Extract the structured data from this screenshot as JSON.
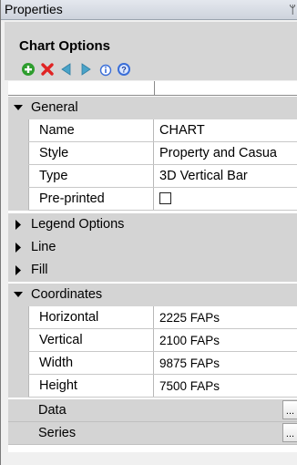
{
  "panel": {
    "title": "Properties",
    "pin_icon": "pin-icon"
  },
  "header": {
    "title": "Chart Options"
  },
  "toolbar": {
    "items": [
      {
        "icon": "add-icon",
        "color": "#2e9d2e"
      },
      {
        "icon": "delete-icon",
        "color": "#e02424"
      },
      {
        "icon": "move-left-icon",
        "color": "#4aa3c8"
      },
      {
        "icon": "move-right-icon",
        "color": "#4aa3c8"
      },
      {
        "icon": "info-icon",
        "color": "#3a6ed8"
      },
      {
        "icon": "help-icon",
        "color": "#3a6ed8"
      }
    ]
  },
  "grid": {
    "general": {
      "label": "General",
      "name_label": "Name",
      "name_value": "CHART",
      "style_label": "Style",
      "style_value": "Property and Casua",
      "type_label": "Type",
      "type_value": "3D Vertical Bar",
      "preprinted_label": "Pre-printed",
      "preprinted_checked": false
    },
    "legend_options": {
      "label": "Legend Options"
    },
    "line": {
      "label": "Line"
    },
    "fill": {
      "label": "Fill"
    },
    "coordinates": {
      "label": "Coordinates",
      "horizontal_label": "Horizontal",
      "horizontal_value": "2225 FAPs",
      "vertical_label": "Vertical",
      "vertical_value": "2100 FAPs",
      "width_label": "Width",
      "width_value": "9875 FAPs",
      "height_label": "Height",
      "height_value": "7500 FAPs"
    },
    "data": {
      "label": "Data",
      "button": "..."
    },
    "series": {
      "label": "Series",
      "button": "..."
    }
  }
}
